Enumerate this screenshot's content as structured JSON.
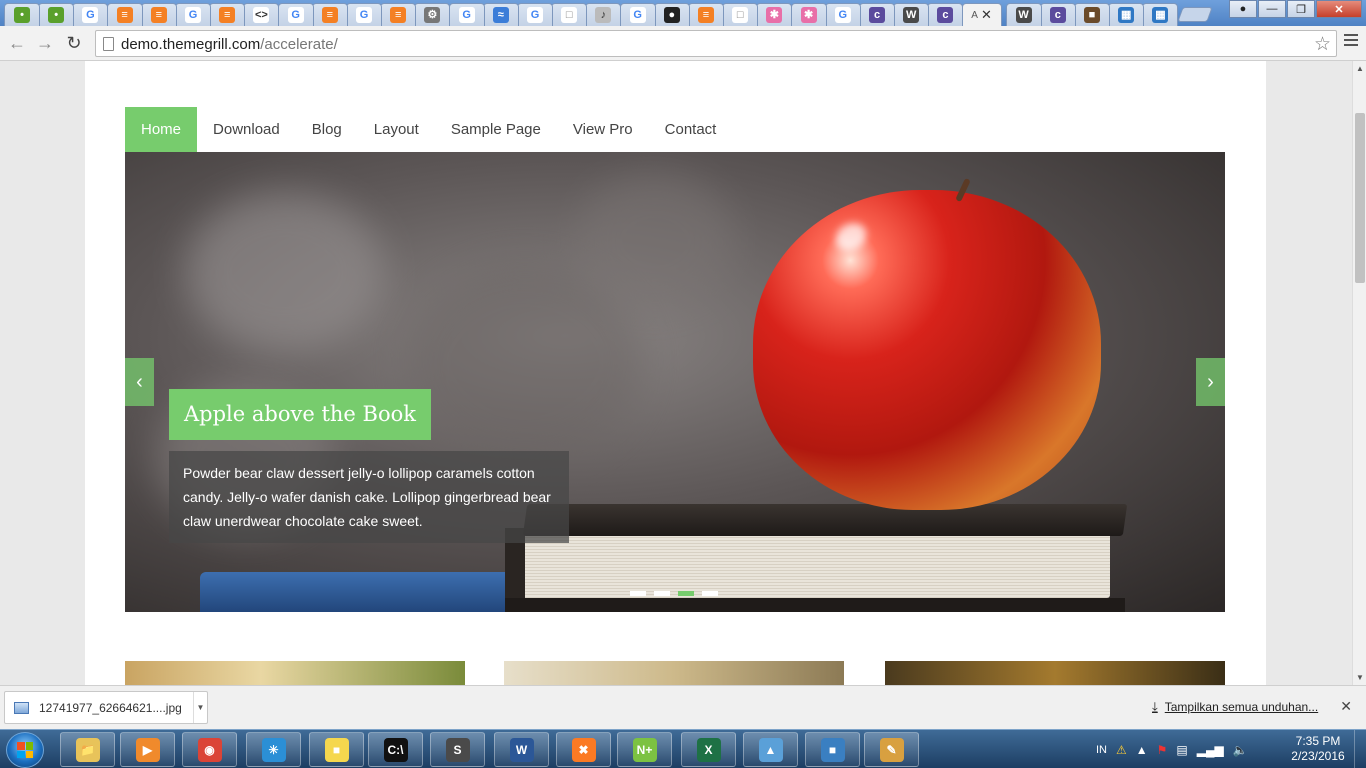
{
  "browser": {
    "tab_favicons": [
      "green-circle",
      "green-circle",
      "google",
      "stack",
      "stack",
      "google",
      "stack",
      "code",
      "google",
      "stack",
      "google",
      "stack",
      "gear",
      "google",
      "wave",
      "google",
      "page",
      "speaker",
      "google",
      "github",
      "stack",
      "page",
      "asterisk",
      "asterisk",
      "google",
      "colorlib",
      "wordpress",
      "colorlib",
      "active",
      "wordpress",
      "colorlib",
      "photo",
      "windows",
      "windows"
    ],
    "active_tab_label": "A",
    "url_host": "demo.themegrill.com",
    "url_path": "/accelerate/"
  },
  "site": {
    "nav": [
      "Home",
      "Download",
      "Blog",
      "Layout",
      "Sample Page",
      "View Pro",
      "Contact"
    ],
    "slide": {
      "title": "Apple above the Book",
      "description": "Powder bear claw dessert jelly-o lollipop caramels cotton candy. Jelly-o wafer danish cake. Lollipop gingerbread bear claw unerdwear chocolate cake sweet.",
      "active_dot": 3,
      "dot_count": 4
    },
    "accent_color": "#77cc6d"
  },
  "downloads": {
    "file_name": "12741977_62664621....jpg",
    "show_all": "Tampilkan semua unduhan..."
  },
  "taskbar": {
    "apps": [
      "Windows Explorer",
      "Media Player",
      "Google Chrome",
      "Sourcetree",
      "Sticky Notes",
      "Command Prompt",
      "Sublime Text",
      "Microsoft Word",
      "XAMPP",
      "Notepad++",
      "Microsoft Excel",
      "Network Tool",
      "VirtualBox",
      "Paint"
    ],
    "language": "IN",
    "time": "7:35 PM",
    "date": "2/23/2016"
  }
}
